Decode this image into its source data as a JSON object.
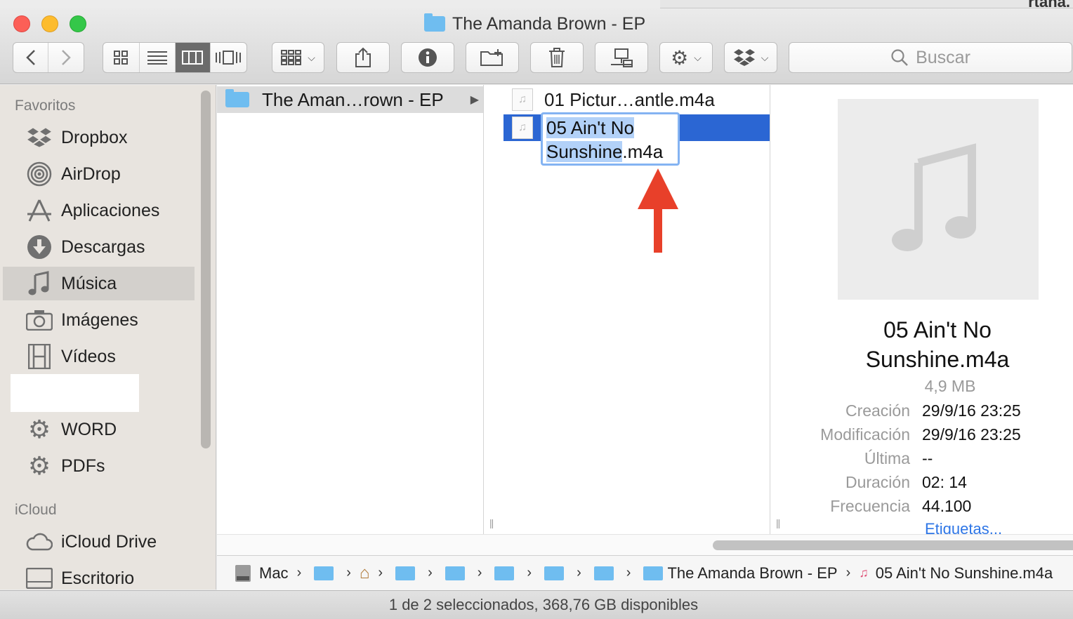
{
  "window": {
    "title": "The Amanda Brown - EP"
  },
  "desktop": {
    "background_text": "rtana."
  },
  "toolbar": {
    "search_placeholder": "Buscar"
  },
  "sidebar": {
    "favorites_header": "Favoritos",
    "icloud_header": "iCloud",
    "items": [
      {
        "label": "Dropbox",
        "icon": "dropbox-icon"
      },
      {
        "label": "AirDrop",
        "icon": "airdrop-icon"
      },
      {
        "label": "Aplicaciones",
        "icon": "applications-icon"
      },
      {
        "label": "Descargas",
        "icon": "downloads-icon"
      },
      {
        "label": "Música",
        "icon": "music-icon",
        "selected": true
      },
      {
        "label": "Imágenes",
        "icon": "camera-icon"
      },
      {
        "label": "Vídeos",
        "icon": "film-icon"
      },
      {
        "label": "WORD",
        "icon": "gear-folder-icon"
      },
      {
        "label": "PDFs",
        "icon": "gear-folder-icon"
      }
    ],
    "icloud_items": [
      {
        "label": "iCloud Drive",
        "icon": "cloud-icon"
      },
      {
        "label": "Escritorio",
        "icon": "desktop-icon"
      }
    ]
  },
  "columns": {
    "col1": {
      "folder_name": "The Aman…rown - EP"
    },
    "col2": {
      "files": [
        {
          "name": "01 Pictur…antle.m4a"
        },
        {
          "name": "05 Ain't No Sunshine.m4a",
          "selected": true
        }
      ],
      "rename": {
        "line1": "05 Ain't No",
        "line2_selected": "Sunshine",
        "line2_rest": ".m4a"
      }
    }
  },
  "preview": {
    "title_line1": "05 Ain't No",
    "title_line2": "Sunshine.m4a",
    "size": "4,9 MB",
    "fields": [
      {
        "label": "Creación",
        "value": "29/9/16 23:25"
      },
      {
        "label": "Modificación",
        "value": "29/9/16 23:25"
      },
      {
        "label": "Última",
        "value": "--"
      },
      {
        "label": "Duración",
        "value": "02: 14"
      },
      {
        "label": "Frecuencia",
        "value": "44.100"
      }
    ],
    "tags_link": "Etiquetas..."
  },
  "pathbar": {
    "root": "Mac",
    "folder": "The Amanda Brown - EP",
    "file": "05 Ain't No Sunshine.m4a"
  },
  "status": {
    "text": "1 de 2 seleccionados, 368,76 GB disponibles"
  },
  "colors": {
    "selection": "#2b66d3",
    "rename_highlight": "#b2d1f8",
    "annotation_arrow": "#e8402a"
  }
}
